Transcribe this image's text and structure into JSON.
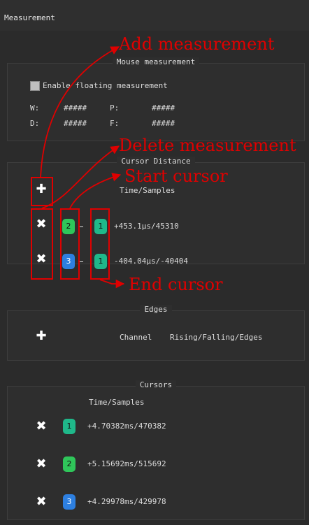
{
  "panel": {
    "title": "Measurement"
  },
  "mouse_measurement": {
    "title": "Mouse measurement",
    "enable_label": "Enable floating measurement",
    "w_label": "W:",
    "w_value": "#####",
    "p_label": "P:",
    "p_value": "#####",
    "d_label": "D:",
    "d_value": "#####",
    "f_label": "F:",
    "f_value": "#####"
  },
  "cursor_distance": {
    "title": "Cursor Distance",
    "header": "Time/Samples",
    "rows": [
      {
        "start": "2",
        "end": "1",
        "value": "+453.1µs/45310"
      },
      {
        "start": "3",
        "end": "1",
        "value": "-404.04µs/-40404"
      }
    ]
  },
  "edges": {
    "title": "Edges",
    "channel_label": "Channel",
    "edges_label": "Rising/Falling/Edges"
  },
  "cursors": {
    "title": "Cursors",
    "header": "Time/Samples",
    "rows": [
      {
        "id": "1",
        "value": "+4.70382ms/470382"
      },
      {
        "id": "2",
        "value": "+5.15692ms/515692"
      },
      {
        "id": "3",
        "value": "+4.29978ms/429978"
      }
    ]
  },
  "annotations": {
    "add": "Add measurement",
    "delete": "Delete measurement",
    "start": "Start cursor",
    "end": "End cursor"
  },
  "colors": {
    "cursor_1": "#1fb88a",
    "cursor_2": "#2fc65a",
    "cursor_3": "#2d7fe0",
    "annotation": "#e00000",
    "panel_bg": "#2b2b2b"
  }
}
